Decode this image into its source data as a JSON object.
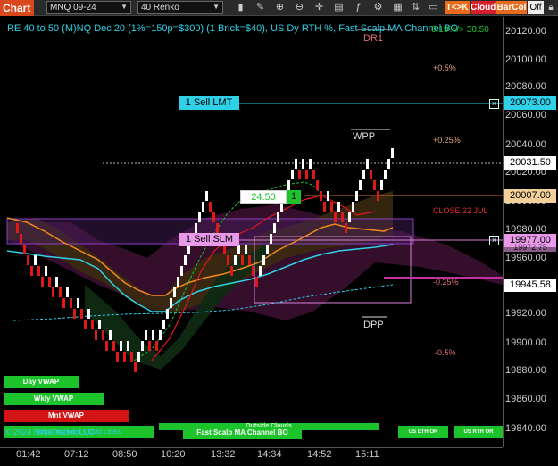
{
  "toolbar": {
    "chart_tab": "Chart",
    "instrument": "MNQ 09-24",
    "bar_type": "40 Renko",
    "tk_label": "T<>K",
    "cloud_label": "Cloud",
    "barcol_label": "BarCol",
    "off_label": "Off",
    "icons": [
      "bars-icon",
      "pencil-icon",
      "zoom-in-icon",
      "zoom-out-icon",
      "crosshair-icon",
      "properties-icon",
      "indicators-icon",
      "strategies-icon",
      "templates-icon",
      "chart-trader-icon",
      "data-box-icon"
    ]
  },
  "chart": {
    "title": "RE 40 to 50 (M)NQ Dec 20 (1%=150p=$300) (1 Brick=$40), US Dy RTH %, Fast Scalp MA Channel BO",
    "corner_value": "0.19%/> 30.50",
    "dr1": "DR1",
    "wpp": "WPP",
    "dpp": "DPP",
    "close_label": "CLOSE 22 JUL",
    "pct_labels": {
      "p05": "+0.5%",
      "p025": "+0.25%",
      "m025": "-0.25%",
      "m05": "-0.5%"
    },
    "sell_lmt": "1 Sell LMT",
    "sell_slm": "1 Sell SLM",
    "pnl_value": "24.50",
    "position_qty": "1",
    "close_x": "×",
    "copyright": "© 2024 NinjaTrader, LLC",
    "legend_name": "Ichimoku Fast Cloud Lines",
    "outside_clouds": "Outside Clouds"
  },
  "buttons": {
    "day_vwap": "Day VWAP",
    "wkly_vwap": "Wkly VWAP",
    "mnt_vwap": "Mnt VWAP",
    "fast_scalp": "Fast Scalp MA Channel BO",
    "us_eth_or": "US ETH OR",
    "us_rth_or": "US RTH OR"
  },
  "price_axis": {
    "ticks": [
      "20120.00",
      "20100.00",
      "20080.00",
      "20060.00",
      "20040.00",
      "20020.00",
      "20000.00",
      "19980.00",
      "19960.00",
      "19940.00",
      "19920.00",
      "19900.00",
      "19880.00",
      "19860.00",
      "19840.00"
    ],
    "sell_lmt_price": "20073.00",
    "last_price": "20031.50",
    "close_price": "20007.00",
    "slm_price": "19977.00",
    "partial_price": "19972.75",
    "ma_price": "19945.58"
  },
  "time_axis": [
    "01:42",
    "07:12",
    "08:50",
    "10:20",
    "13:32",
    "14:34",
    "14:52",
    "15:11"
  ],
  "colors": {
    "up": "#ffffff",
    "down": "#e01818",
    "cyan": "#2fd0e8",
    "orange": "#f08a1c",
    "magenta": "#c0329c",
    "green": "#1cc32a"
  }
}
